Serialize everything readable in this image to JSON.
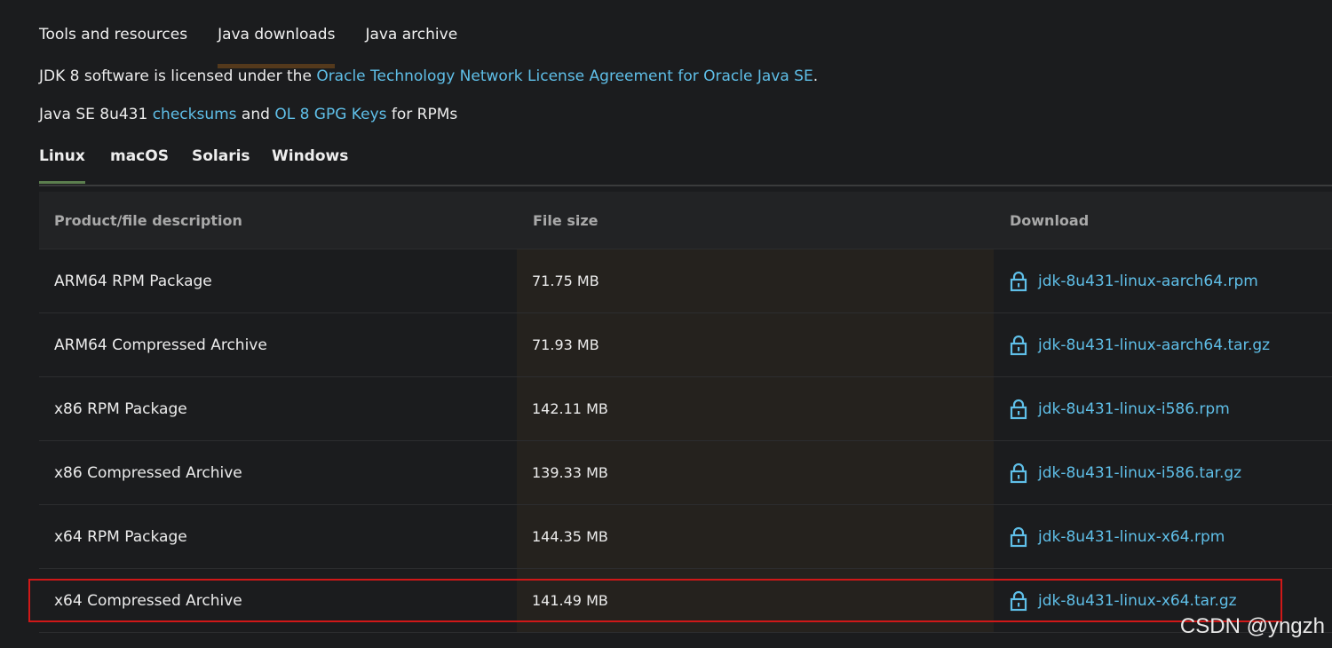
{
  "top_nav": {
    "items": [
      {
        "label": "Tools and resources",
        "active": false
      },
      {
        "label": "Java downloads",
        "active": true
      },
      {
        "label": "Java archive",
        "active": false
      }
    ]
  },
  "license": {
    "prefix": "JDK 8 software is licensed under the ",
    "link": "Oracle Technology Network License Agreement for Oracle Java SE",
    "suffix": "."
  },
  "checks": {
    "prefix": "Java SE 8u431 ",
    "checksums_link": "checksums",
    "middle": " and ",
    "gpg_link": "OL 8 GPG Keys",
    "suffix": " for RPMs"
  },
  "os_tabs": [
    {
      "label": "Linux",
      "active": true
    },
    {
      "label": "macOS",
      "active": false
    },
    {
      "label": "Solaris",
      "active": false
    },
    {
      "label": "Windows",
      "active": false
    }
  ],
  "table": {
    "headers": {
      "description": "Product/file description",
      "size": "File size",
      "download": "Download"
    },
    "rows": [
      {
        "description": "ARM64 RPM Package",
        "size": "71.75 MB",
        "file": "jdk-8u431-linux-aarch64.rpm"
      },
      {
        "description": "ARM64 Compressed Archive",
        "size": "71.93 MB",
        "file": "jdk-8u431-linux-aarch64.tar.gz"
      },
      {
        "description": "x86 RPM Package",
        "size": "142.11 MB",
        "file": "jdk-8u431-linux-i586.rpm"
      },
      {
        "description": "x86 Compressed Archive",
        "size": "139.33 MB",
        "file": "jdk-8u431-linux-i586.tar.gz"
      },
      {
        "description": "x64 RPM Package",
        "size": "144.35 MB",
        "file": "jdk-8u431-linux-x64.rpm"
      },
      {
        "description": "x64 Compressed Archive",
        "size": "141.49 MB",
        "file": "jdk-8u431-linux-x64.tar.gz",
        "highlighted": true
      }
    ]
  },
  "icons": {
    "download": "lock-icon"
  },
  "colors": {
    "background": "#1b1c1e",
    "link": "#5fbfe8",
    "active_nav_underline": "#54391c",
    "active_tab_underline": "#5c7f4f",
    "highlight_border": "#d01818"
  },
  "watermark": "CSDN @yngzh"
}
